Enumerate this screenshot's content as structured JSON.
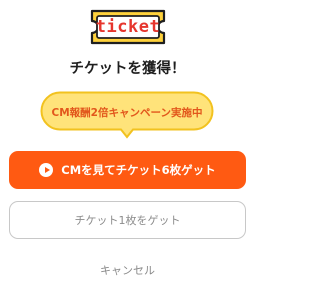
{
  "logo": {
    "text": "ticket"
  },
  "title": "チケットを獲得！",
  "campaign": {
    "text": "CM報酬2倍キャンペーン実施中"
  },
  "buttons": {
    "watch_cm": "CMを見てチケット6枚ゲット",
    "get_one": "チケット1枚をゲット",
    "cancel": "キャンセル"
  },
  "colors": {
    "accent": "#ff5a12",
    "ticket_bg": "#ffd23c",
    "ticket_text": "#e6352d",
    "campaign_bg": "#ffe37a",
    "campaign_border": "#f2c21f",
    "campaign_text": "#e2571c"
  }
}
